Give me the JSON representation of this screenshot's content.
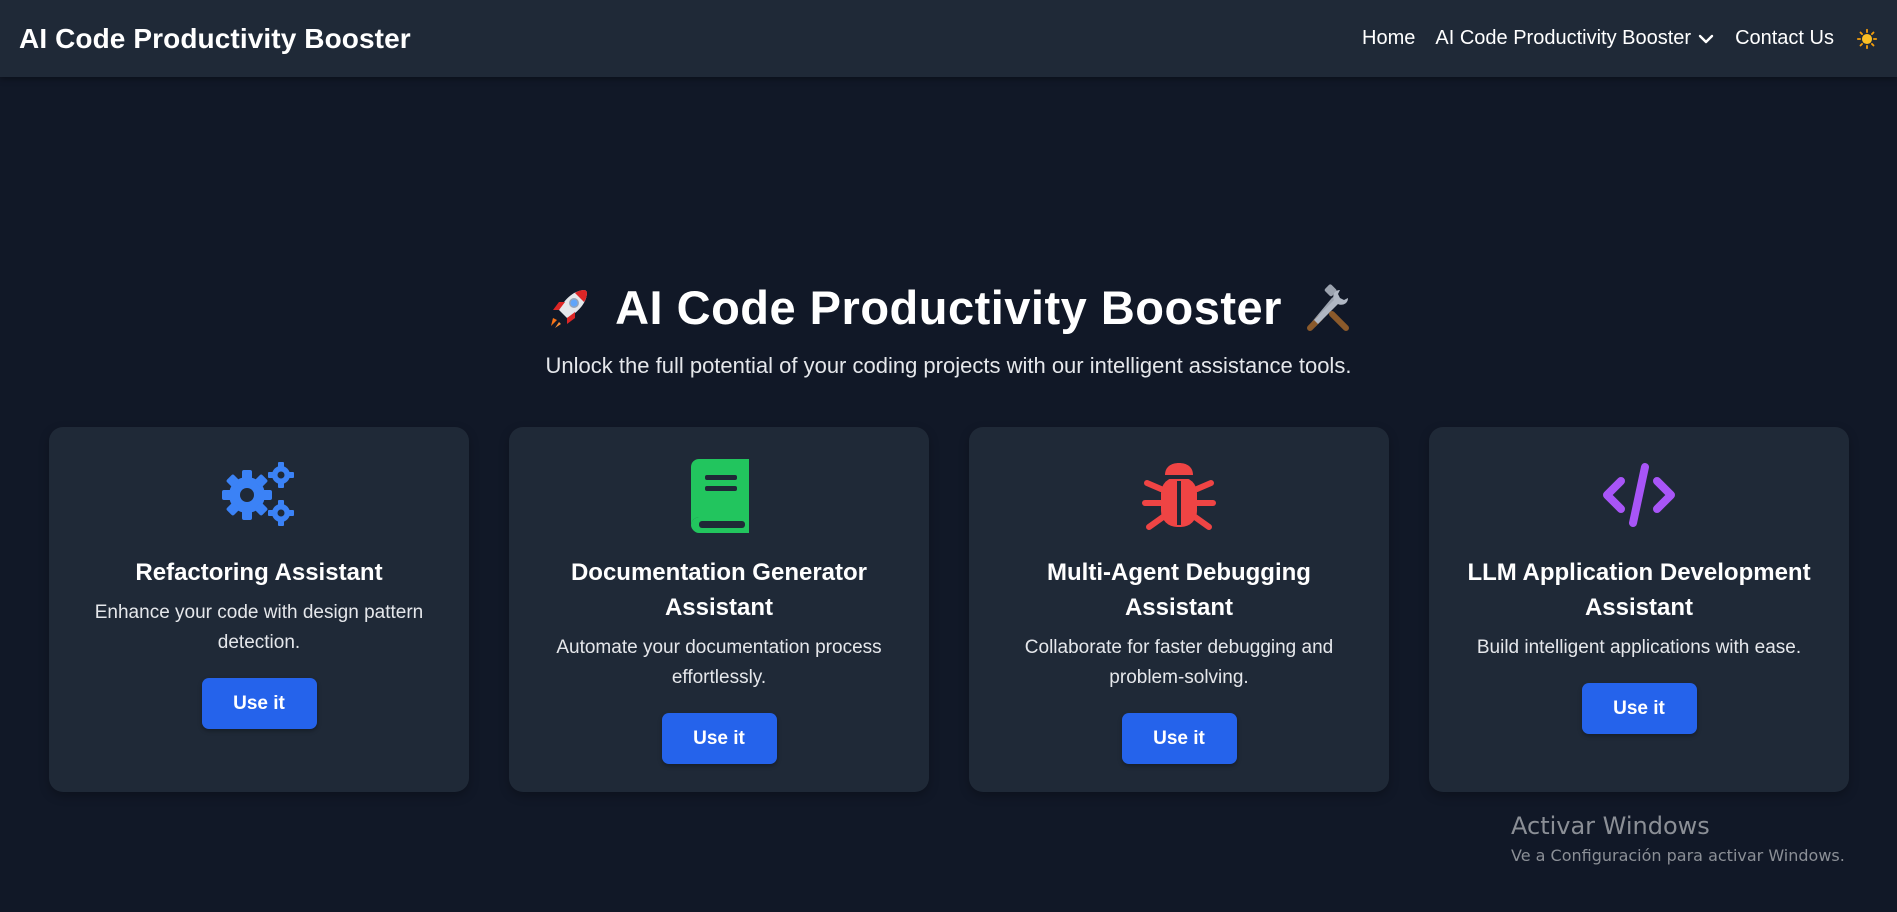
{
  "navbar": {
    "brand": "AI Code Productivity Booster",
    "links": {
      "home": "Home",
      "dropdown": "AI Code Productivity Booster",
      "contact": "Contact Us"
    },
    "theme_icon": "sun-icon"
  },
  "hero": {
    "title": "AI Code Productivity Booster",
    "subtitle": "Unlock the full potential of your coding projects with our intelligent assistance tools.",
    "left_icon": "rocket-icon",
    "right_icon": "tools-icon"
  },
  "cards": [
    {
      "icon": "cogs-icon",
      "icon_color": "#3b82f6",
      "title": "Refactoring Assistant",
      "description": "Enhance your code with design pattern detection.",
      "button": "Use it"
    },
    {
      "icon": "book-icon",
      "icon_color": "#22c55e",
      "title": "Documentation Generator Assistant",
      "description": "Automate your documentation process effortlessly.",
      "button": "Use it"
    },
    {
      "icon": "bug-icon",
      "icon_color": "#ef4444",
      "title": "Multi-Agent Debugging Assistant",
      "description": "Collaborate for faster debugging and problem-solving.",
      "button": "Use it"
    },
    {
      "icon": "code-icon",
      "icon_color": "#a855f7",
      "title": "LLM Application Development Assistant",
      "description": "Build intelligent applications with ease.",
      "button": "Use it"
    }
  ],
  "watermark": {
    "title": "Activar Windows",
    "subtitle": "Ve a Configuración para activar Windows."
  },
  "colors": {
    "background": "#111827",
    "navbar": "#1f2937",
    "card": "#1f2937",
    "button": "#2563eb"
  }
}
